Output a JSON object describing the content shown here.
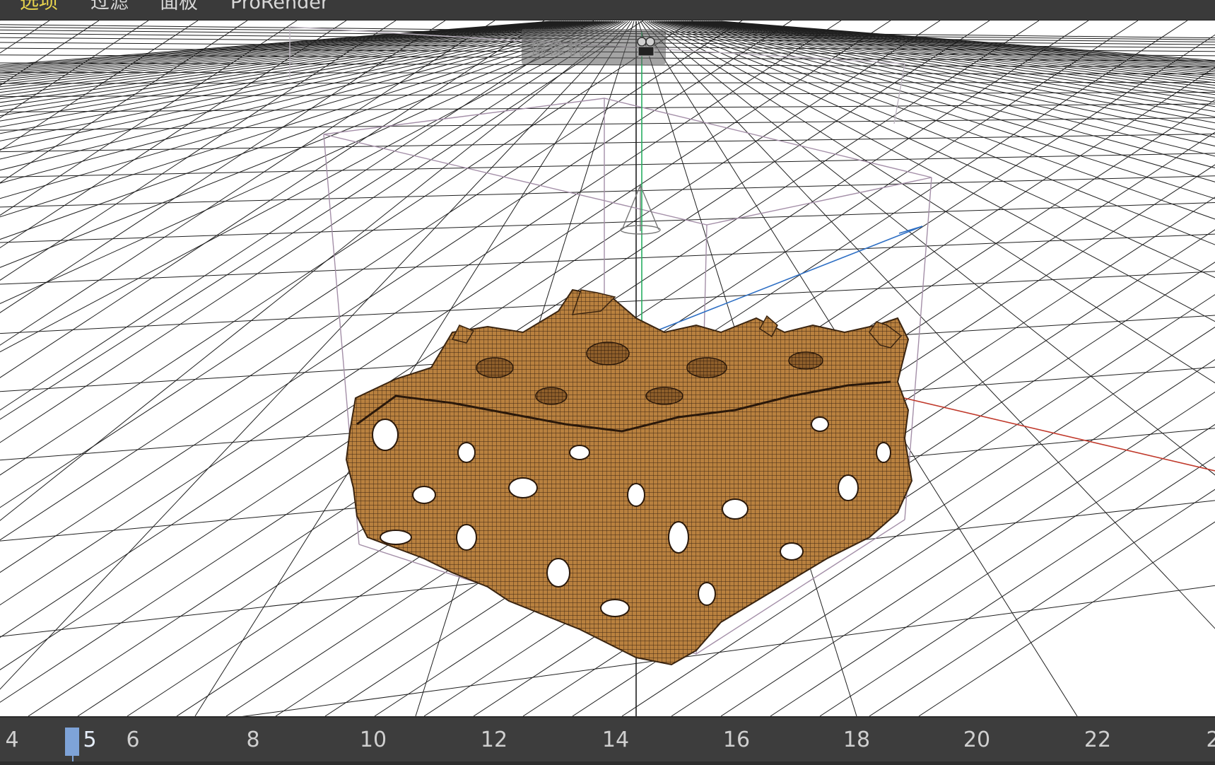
{
  "menu": {
    "items": [
      "选项",
      "过滤",
      "面板",
      "ProRender"
    ],
    "active_index": 0
  },
  "viewport": {
    "camera_label": "摄像机",
    "icons": [
      "camera-icon",
      "move-gizmo-icon"
    ],
    "colors": {
      "background": "#ffffff",
      "grid": "#222222",
      "x_axis": "#c0392b",
      "y_axis": "#27ae60",
      "z_axis": "#2e6fc4",
      "object": "#b07a3a",
      "bounding_box": "#a48fa8"
    }
  },
  "timeline": {
    "ticks": [
      "4",
      "5",
      "6",
      "8",
      "10",
      "12",
      "14",
      "16",
      "18",
      "20",
      "22",
      "2"
    ],
    "current_frame": "5",
    "playhead_color": "#7ea3d8"
  }
}
